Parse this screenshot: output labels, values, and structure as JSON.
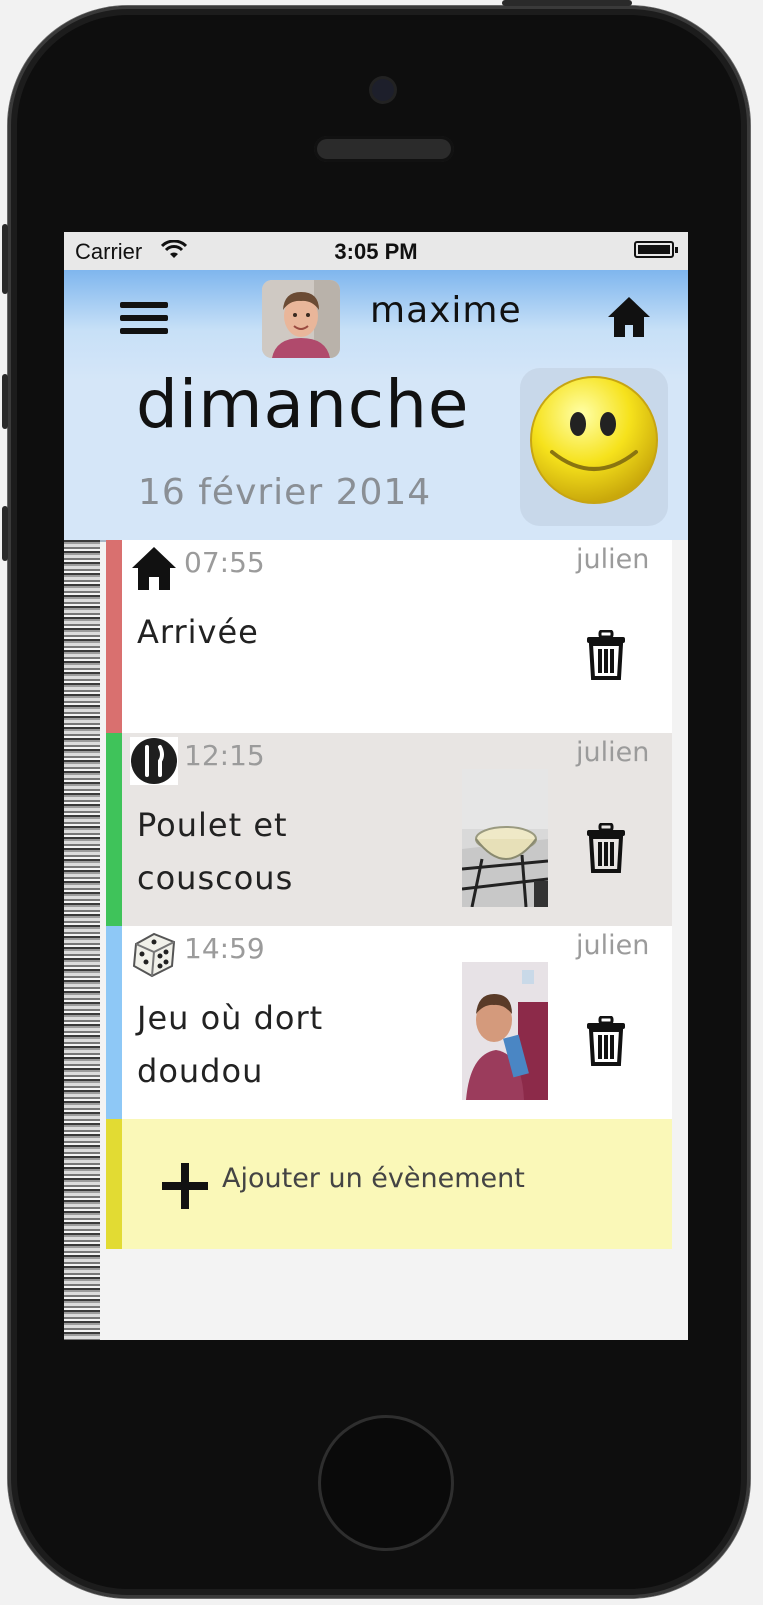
{
  "status_bar": {
    "carrier": "Carrier",
    "time": "3:05 PM"
  },
  "header": {
    "user_name": "maxime",
    "day": "dimanche",
    "date": "16 février 2014",
    "mood": "smiley-icon"
  },
  "events": [
    {
      "time": "07:55",
      "title": "Arrivée",
      "author": "julien",
      "icon": "house-icon",
      "stripe_color": "#d9706f",
      "bg": "#ffffff",
      "has_photo": false
    },
    {
      "time": "12:15",
      "title": "Poulet et couscous",
      "author": "julien",
      "icon": "fork-knife-icon",
      "stripe_color": "#3fc35a",
      "bg": "#e8e5e3",
      "has_photo": true
    },
    {
      "time": "14:59",
      "title": "Jeu où dort doudou",
      "author": "julien",
      "icon": "dice-icon",
      "stripe_color": "#8ec8f6",
      "bg": "#ffffff",
      "has_photo": true
    }
  ],
  "add_event_label": "Ajouter un évènement"
}
